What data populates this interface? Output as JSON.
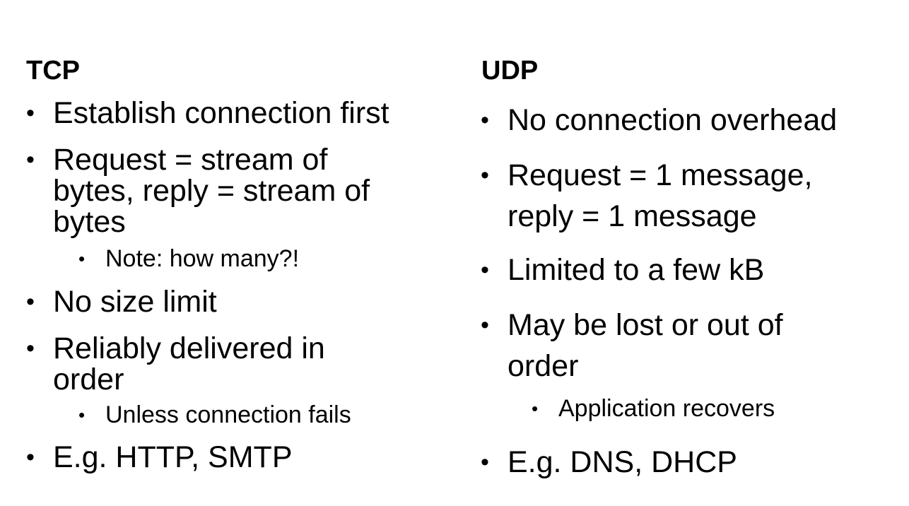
{
  "tcp": {
    "heading": "TCP",
    "bullets": [
      {
        "lines": [
          "Establish connection first"
        ]
      },
      {
        "lines": [
          "Request = stream of",
          "bytes, reply = stream of",
          "bytes"
        ]
      },
      {
        "lines": [
          "No size limit"
        ]
      },
      {
        "lines": [
          "Reliably delivered in",
          "order"
        ]
      },
      {
        "lines": [
          "E.g. HTTP, SMTP"
        ]
      }
    ],
    "subbullets": [
      "Note: how many?!",
      "Unless connection fails"
    ]
  },
  "udp": {
    "heading": "UDP",
    "bullets": [
      {
        "lines": [
          "No connection overhead"
        ]
      },
      {
        "lines": [
          "Request = 1 message,",
          "reply = 1 message"
        ]
      },
      {
        "lines": [
          "Limited to a few kB"
        ]
      },
      {
        "lines": [
          "May be lost or out of",
          "order"
        ]
      },
      {
        "lines": [
          "E.g. DNS, DHCP"
        ]
      }
    ],
    "subbullets": [
      "Application recovers"
    ]
  },
  "bullet_glyph": "•"
}
